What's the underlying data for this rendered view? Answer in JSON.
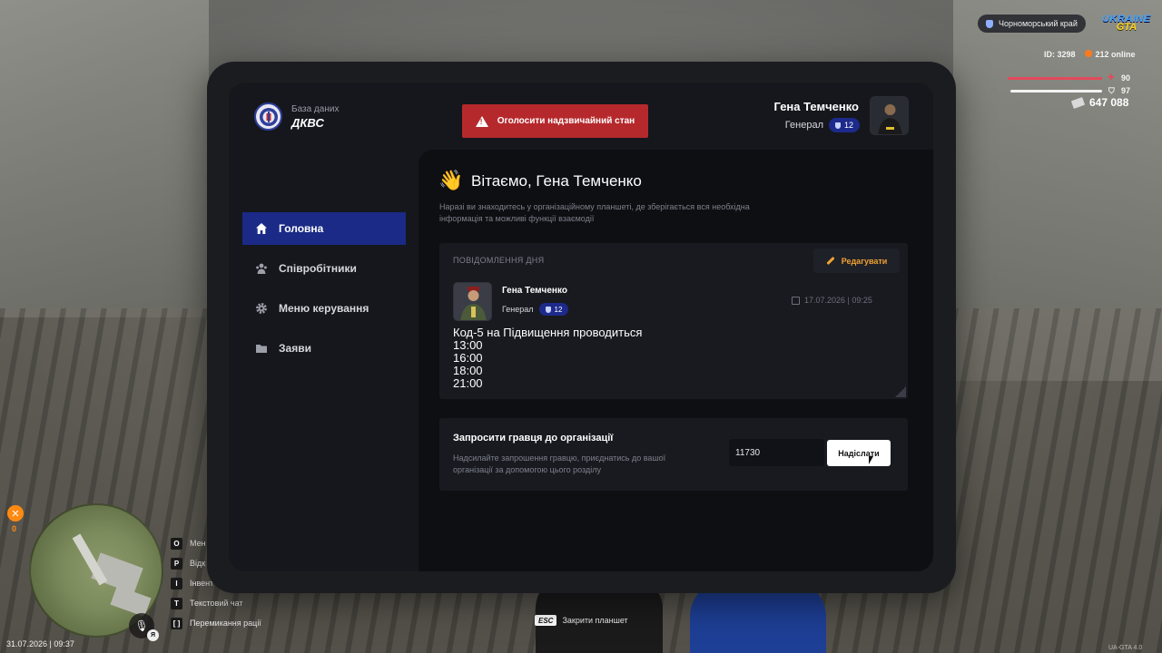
{
  "hud": {
    "region": "Чорноморський край",
    "logo_line1": "UKRAINE",
    "logo_line2": "GTA",
    "player_id": "ID: 3298",
    "online": "212 online",
    "health": "90",
    "armor": "97",
    "money": "647 088",
    "hunger": "0",
    "datetime": "31.07.2026 | 09:37",
    "voice_lang": "Я",
    "keys": [
      {
        "key": "O",
        "label": "Мен"
      },
      {
        "key": "P",
        "label": "Відк"
      },
      {
        "key": "I",
        "label": "Інвент"
      },
      {
        "key": "T",
        "label": "Текстовий чат"
      },
      {
        "key": "[  ]",
        "label": "Перемикання рації"
      }
    ],
    "esc_key": "ESC",
    "esc_label": "Закрити планшет",
    "version": "UA-GTA 4.0"
  },
  "brand": {
    "subtitle": "База даних",
    "title": "ДКВС"
  },
  "emergency_button": "Оголосити надзвичайний стан",
  "user": {
    "name": "Гена Темченко",
    "rank": "Генерал",
    "rank_level": "12"
  },
  "nav": [
    {
      "label": "Головна",
      "icon": "home-icon",
      "active": true
    },
    {
      "label": "Співробітники",
      "icon": "people-icon",
      "active": false
    },
    {
      "label": "Меню керування",
      "icon": "gear-icon",
      "active": false
    },
    {
      "label": "Заяви",
      "icon": "folder-icon",
      "active": false
    }
  ],
  "main": {
    "greeting": "Вітаємо, Гена Темченко",
    "intro": "Наразі ви знаходитесь у організаційному планшеті, де зберігається вся необхідна інформація та можливі функції взаємодії",
    "motd": {
      "label": "ПОВІДОМЛЕННЯ ДНЯ",
      "edit_label": "Редагувати",
      "author_name": "Гена Темченко",
      "author_rank": "Генерал",
      "author_rank_level": "12",
      "date": "17.07.2026 | 09:25",
      "lines": [
        "Код-5 на Підвищення проводиться",
        "13:00",
        "16:00",
        "18:00",
        "21:00"
      ]
    },
    "invite": {
      "title": "Запросити гравця до організації",
      "description": "Надсилайте запрошення гравцю, приєднатись до вашої організації за допомогою цього розділу",
      "input_value": "11730",
      "button": "Надіслати"
    }
  },
  "colors": {
    "accent_blue": "#1b2a86",
    "danger": "#b5292c",
    "edit_orange": "#f1a233"
  }
}
